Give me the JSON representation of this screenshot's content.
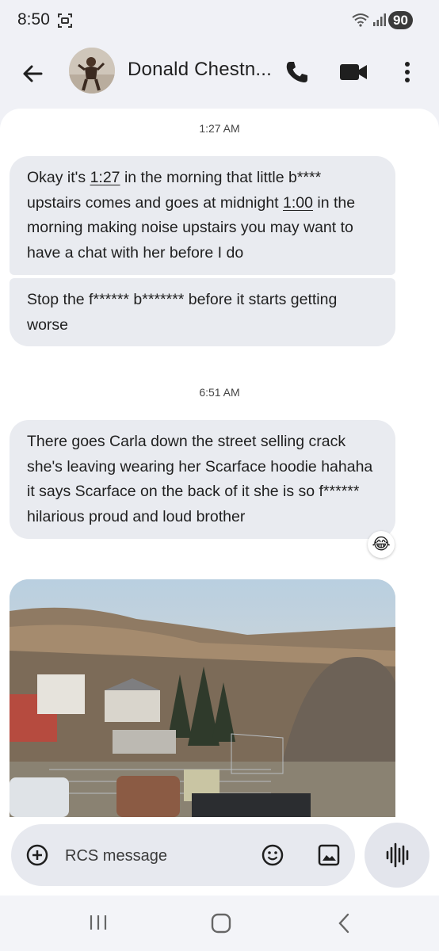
{
  "status_bar": {
    "time": "8:50",
    "battery": "90"
  },
  "header": {
    "contact_name": "Donald Chestn...",
    "back_icon": "arrow-back-icon",
    "call_icon": "phone-icon",
    "video_icon": "video-camera-icon",
    "more_icon": "more-vertical-icon"
  },
  "messages": [
    {
      "time": "1:27 AM"
    },
    {
      "parts": [
        "Okay it's ",
        "1:27",
        " in the morning that little b**** upstairs comes and goes at midnight ",
        "1:00",
        " in the morning making noise upstairs you may want to have a chat with her before I do"
      ]
    },
    {
      "text": "Stop the f****** b******* before it starts getting worse"
    },
    {
      "time": "6:51 AM"
    },
    {
      "text": "There goes Carla down the street selling crack she's leaving wearing her Scarface hoodie hahaha it says Scarface on the back of it she is so f****** hilarious proud and loud brother",
      "reaction": "😂"
    }
  ],
  "compose": {
    "placeholder": "RCS message"
  },
  "colors": {
    "bubble": "#e9ebf0",
    "panel": "#ffffff",
    "background": "#f0f1f6"
  }
}
